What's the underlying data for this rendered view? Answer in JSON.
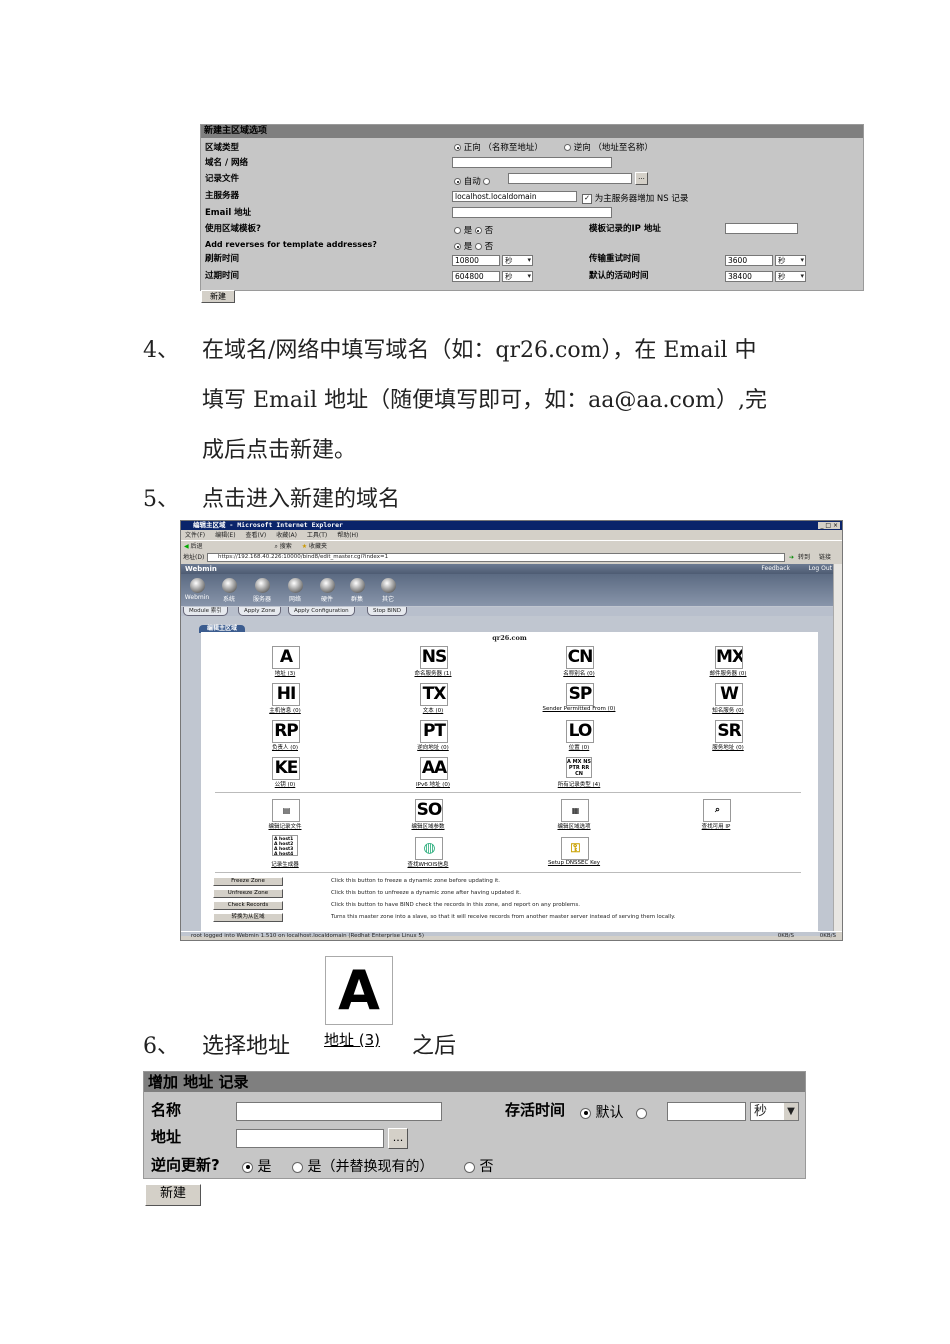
{
  "form1": {
    "header": "新建主区域选项",
    "zone_type_label": "区域类型",
    "zone_forward": "正向 （名称至地址）",
    "zone_reverse": "逆向 （地址至名称）",
    "domain_label": "域名 / 网络",
    "records_file_label": "记录文件",
    "records_auto": "自动",
    "master_server_label": "主服务器",
    "master_server_value": "localhost.localdomain",
    "add_ns_label": "为主服务器增加 NS 记录",
    "email_label": "Email 地址",
    "use_template_label": "使用区域模板?",
    "yes": "是",
    "no": "否",
    "template_ip_label": "模板记录的IP 地址",
    "add_reverses_label": "Add reverses for template addresses?",
    "refresh_label": "刷新时间",
    "refresh_value": "10800",
    "unit_sec": "秒",
    "transfer_retry_label": "传输重试时间",
    "transfer_retry_value": "3600",
    "expire_label": "过期时间",
    "expire_value": "604800",
    "default_ttl_label": "默认的活动时间",
    "default_ttl_value": "38400",
    "create_button": "新建",
    "browse_button": "..."
  },
  "steps": {
    "step4_num": "4、",
    "step4_line1": "在域名/网络中填写域名（如：qr26.com），在 Email 中",
    "step4_line2": "填写 Email 地址（随便填写即可，如：aa@aa.com）,完",
    "step4_line3": "成后点击新建。",
    "step5_num": "5、",
    "step5_text": "点击进入新建的域名",
    "step6_num": "6、",
    "step6_text_a": "选择地址",
    "step6_text_b": "之后"
  },
  "browser": {
    "title": "编辑主区域 - Microsoft Internet Explorer",
    "menu": [
      "文件(F)",
      "编辑(E)",
      "查看(V)",
      "收藏(A)",
      "工具(T)",
      "帮助(H)"
    ],
    "toolbar": [
      "后退",
      "搜索",
      "收藏夹"
    ],
    "address_label": "地址(D)",
    "address": "https://192.168.40.226:10000/bind8/edit_master.cgi?index=1",
    "go": "转到",
    "links": "链接",
    "webmin_brand": "Webmin",
    "feedback": "Feedback",
    "logout": "Log Out",
    "categories": [
      "Webmin",
      "系统",
      "服务器",
      "网络",
      "硬件",
      "群集",
      "其它"
    ],
    "module_tabs": [
      "Module 索引",
      "Apply Zone",
      "Apply Configuration",
      "Stop BIND"
    ],
    "content_tab": "编辑主区域",
    "zone_name": "qr26.com",
    "records": [
      {
        "icon": "A",
        "label": "地址 (3)"
      },
      {
        "icon": "NS",
        "label": "命名服务器 (1)"
      },
      {
        "icon": "CN",
        "label": "名称别名 (0)"
      },
      {
        "icon": "MX",
        "label": "邮件服务器 (0)"
      },
      {
        "icon": "HI",
        "label": "主机信息 (0)"
      },
      {
        "icon": "TX",
        "label": "文本 (0)"
      },
      {
        "icon": "SP",
        "label": "Sender Permitted From (0)"
      },
      {
        "icon": "W",
        "label": "知名服务 (0)"
      },
      {
        "icon": "RP",
        "label": "负责人 (0)"
      },
      {
        "icon": "PT",
        "label": "逆向地址 (0)"
      },
      {
        "icon": "LO",
        "label": "位置 (0)"
      },
      {
        "icon": "SR",
        "label": "服务地址 (0)"
      },
      {
        "icon": "KE",
        "label": "公钥 (0)"
      },
      {
        "icon": "AA",
        "label": "IPv6 地址 (0)"
      },
      {
        "icon": "A MX NS PTR RR CN",
        "label": "所有记录类型 (4)"
      }
    ],
    "tools": [
      {
        "label": "编辑记录文件"
      },
      {
        "icon": "SO",
        "label": "编辑区域参数"
      },
      {
        "label": "编辑区域选项"
      },
      {
        "label": "查找可用 IP"
      },
      {
        "icon": "A host1 A host2 A host3 A host4",
        "label": "记录生成器"
      },
      {
        "label": "查找WHOIS信息"
      },
      {
        "label": "Setup DNSSEC Key"
      }
    ],
    "zone_actions": [
      {
        "button": "Freeze Zone",
        "desc": "Click this button to freeze a dynamic zone before updating it."
      },
      {
        "button": "Unfreeze Zone",
        "desc": "Click this button to unfreeze a dynamic zone after having updated it."
      },
      {
        "button": "Check Records",
        "desc": "Click this button to have BIND check the records in this zone, and report on any problems."
      },
      {
        "button": "转换为从区域",
        "desc": "Turns this master zone into a slave, so that it will receive records from another master server instead of serving them locally."
      }
    ],
    "status": "root logged into Webmin 1.510 on localhost.localdomain (Redhat Enterprise Linux 5)",
    "speed1": "0KB/S",
    "speed2": "0KB/S"
  },
  "big_icon": {
    "letter": "A",
    "caption": "地址 (3)"
  },
  "form2": {
    "header": "增加 地址 记录",
    "name_label": "名称",
    "ttl_label": "存活时间",
    "default_label": "默认",
    "unit": "秒",
    "address_label": "地址",
    "browse": "...",
    "reverse_label": "逆向更新?",
    "opt_yes": "是",
    "opt_yes_replace": "是（并替换现有的）",
    "opt_no": "否",
    "create_button": "新建"
  }
}
